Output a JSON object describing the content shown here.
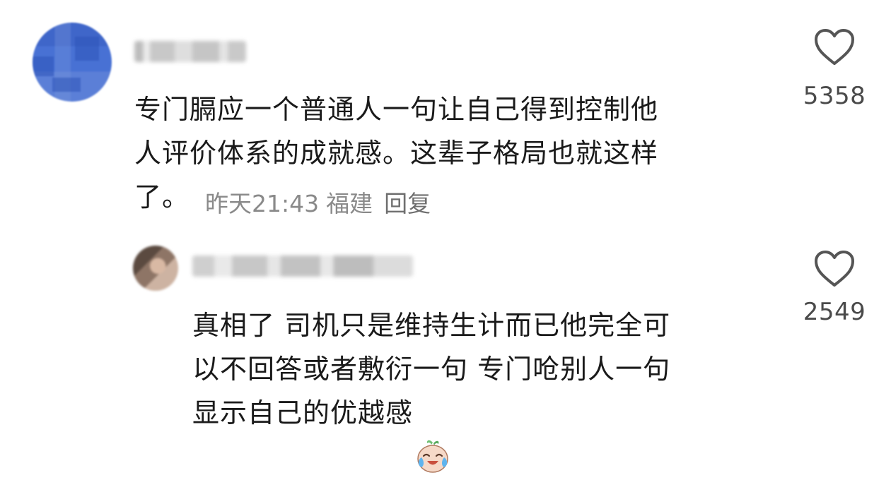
{
  "comments": {
    "main": {
      "text": "专门膈应一个普通人一句让自己得到控制他\n人评价体系的成就感。这辈子格局也就这样\n了。",
      "time": "昨天21:43",
      "location": "福建",
      "reply_label": "回复",
      "likes": "5358"
    },
    "reply": {
      "text": "真相了 司机只是维持生计而已他完全可\n以不回答或者敷衍一句  专门呛别人一句\n显示自己的优越感",
      "emoji_icon": "crying-laughing-emoji-icon",
      "likes": "2549"
    }
  },
  "colors": {
    "text": "#1a1a1a",
    "meta": "#8a8a8a",
    "like_icon": "#555555"
  }
}
